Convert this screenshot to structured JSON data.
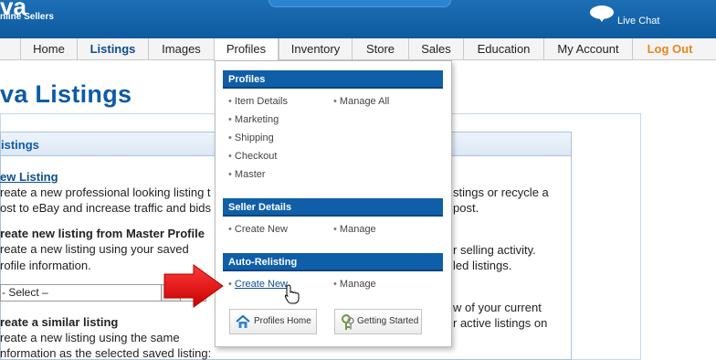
{
  "header": {
    "logo_text": "va",
    "logo_subtitle": "nline Sellers",
    "live_chat_label": "Live Chat"
  },
  "nav": {
    "items": [
      {
        "label": "Home"
      },
      {
        "label": "Listings"
      },
      {
        "label": "Images"
      },
      {
        "label": "Profiles"
      },
      {
        "label": "Inventory"
      },
      {
        "label": "Store"
      },
      {
        "label": "Sales"
      },
      {
        "label": "Education"
      },
      {
        "label": "My Account"
      },
      {
        "label": "Log Out"
      }
    ],
    "active": "Listings",
    "open": "Profiles"
  },
  "page": {
    "title": "va Listings",
    "panel_title": "istings",
    "new_listing_link": "ew Listing",
    "new_listing_desc_1": "reate a new professional looking listing t",
    "new_listing_desc_2": "ost to eBay and increase traffic and bids",
    "master_heading": "reate new listing from Master Profile",
    "master_desc_1": "reate a new listing using your saved",
    "master_desc_2": "rofile information.",
    "select_value": "- Select –",
    "similar_heading": "reate a similar listing",
    "similar_desc_1": "reate a new listing using the same",
    "similar_desc_2": "nformation as the selected saved listing:",
    "right_1a": "stings or recycle a",
    "right_1b": "post.",
    "right_2a": "r selling activity.",
    "right_2b": "led listings.",
    "right_3a": "w of your current",
    "right_3b": "r active listings on"
  },
  "dropdown": {
    "profiles_heading": "Profiles",
    "profiles_left": [
      "Item Details",
      "Marketing",
      "Shipping",
      "Checkout",
      "Master"
    ],
    "profiles_right": [
      "Manage All"
    ],
    "seller_heading": "Seller Details",
    "seller_left": "Create New",
    "seller_right": "Manage",
    "relisting_heading": "Auto-Relisting",
    "relisting_left": "Create New",
    "relisting_right": "Manage",
    "bullet": "•",
    "profiles_home_button": "Profiles Home",
    "getting_started_button": "Getting Started"
  },
  "colors": {
    "header_blue": "#0d5aa0",
    "menu_heading_blue": "#0f5ea8",
    "title_blue": "#0e5ba6",
    "logout_orange": "#e8861a",
    "arrow_red": "#e81010"
  },
  "icons": {
    "live_chat": "chat-bubble-icon",
    "profiles_home": "home-icon",
    "getting_started": "keys-icon",
    "pointer": "hand-cursor-icon",
    "annotation": "red-arrow-icon"
  }
}
